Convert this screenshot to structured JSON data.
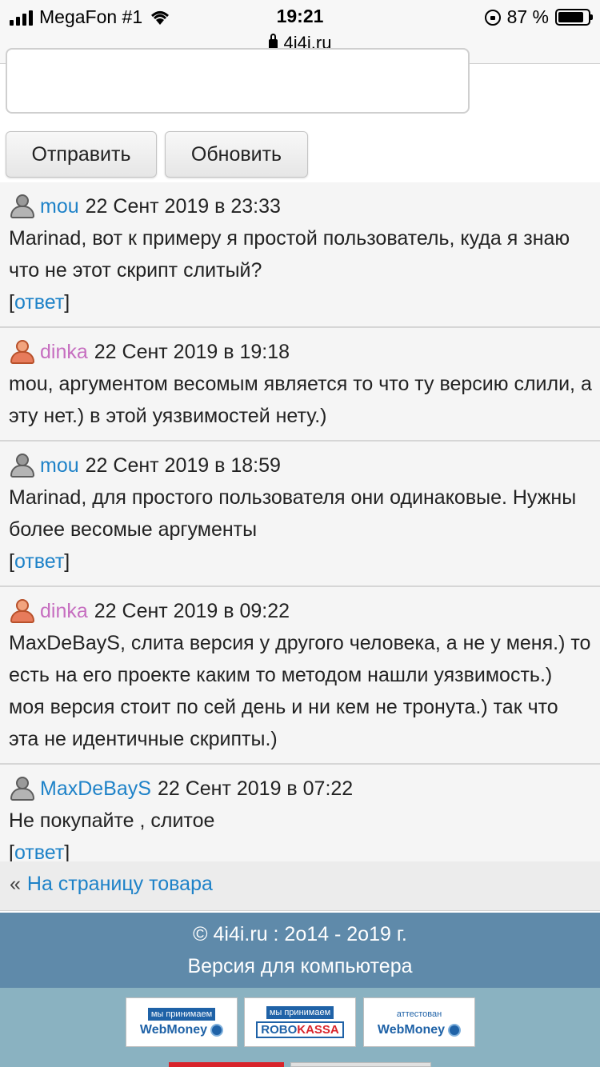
{
  "status_bar": {
    "carrier": "MegaFon #1",
    "time": "19:21",
    "url": "4i4i.ru",
    "battery": "87 %",
    "battery_level": 0.87
  },
  "form": {
    "send_label": "Отправить",
    "refresh_label": "Обновить"
  },
  "comments": [
    {
      "author": "mou",
      "gender": "male",
      "date": "22 Сент 2019 в 23:33",
      "text": "Marinad, вот к примеру я простой пользователь, куда я знаю что не этот скрипт слитый?",
      "reply_label": "ответ"
    },
    {
      "author": "dinka",
      "gender": "female",
      "date": "22 Сент 2019 в 19:18",
      "text": "mou, аргументом весомым является то что ту версию слили, а эту нет.) в этой уязвимостей нету.)",
      "reply_label": ""
    },
    {
      "author": "mou",
      "gender": "male",
      "date": "22 Сент 2019 в 18:59",
      "text": "Marinad, для простого пользователя они одинаковые. Нужны более весомые аргументы",
      "reply_label": "ответ"
    },
    {
      "author": "dinka",
      "gender": "female",
      "date": "22 Сент 2019 в 09:22",
      "text": "MaxDeBayS, слита версия у другого человека, а не у меня.) то есть на его проекте каким то методом нашли уязвимость.) моя версия стоит по сей день и ни кем не тронута.) так что эта не идентичные скрипты.)",
      "reply_label": ""
    },
    {
      "author": "MaxDeBayS",
      "gender": "male",
      "date": "22 Сент 2019 в 07:22",
      "text": "Не покупайте , слитое",
      "reply_label": "ответ"
    }
  ],
  "back_link": {
    "arrow": "«",
    "label": "На страницу товара"
  },
  "footer": {
    "copyright": "© 4i4i.ru : 2о14 - 2о19 г.",
    "desktop_link": "Версия для компьютера",
    "badges": [
      {
        "top": "мы принимаем",
        "brand": "WebMoney"
      },
      {
        "top": "мы принимаем",
        "brand_a": "ROBO",
        "brand_b": "KASSA"
      },
      {
        "top": "аттестован",
        "brand": "WebMoney"
      }
    ]
  },
  "colors": {
    "link": "#1e82c8",
    "female_author": "#c66ec0",
    "footer_dark": "#5f8aaa",
    "footer_light": "#8ab2c1"
  }
}
